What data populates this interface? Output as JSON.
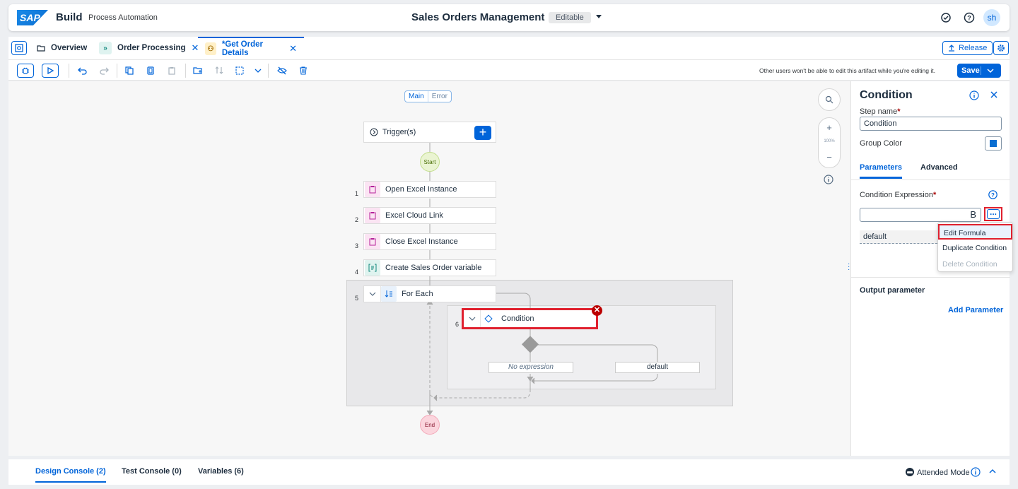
{
  "shell": {
    "logo": "SAP",
    "brand": "Build",
    "product": "Process Automation",
    "project_title": "Sales Orders Management",
    "editable_badge": "Editable",
    "avatar_initials": "sh"
  },
  "tabs": [
    {
      "label": "Overview",
      "icon": "folder-icon"
    },
    {
      "label": "Order Processing",
      "icon": "process-icon"
    },
    {
      "label": "*Get Order Details",
      "icon": "automation-icon"
    }
  ],
  "tabbar": {
    "release_label": "Release"
  },
  "toolbar": {
    "edit_note": "Other users won't be able to edit this artifact while you're editing it.",
    "save_label": "Save"
  },
  "canvas": {
    "main_label": "Main",
    "error_label": "Error",
    "trigger_label": "Trigger(s)",
    "start_label": "Start",
    "end_label": "End",
    "zoom_level": "100%",
    "steps": [
      {
        "num": "1",
        "label": "Open Excel Instance"
      },
      {
        "num": "2",
        "label": "Excel Cloud Link"
      },
      {
        "num": "3",
        "label": "Close Excel Instance"
      },
      {
        "num": "4",
        "label": "Create Sales Order variable"
      },
      {
        "num": "5",
        "label": "For Each"
      },
      {
        "num": "6",
        "label": "Condition"
      }
    ],
    "branch_no_expression": "No expression",
    "branch_default": "default"
  },
  "panel": {
    "title": "Condition",
    "step_name_label": "Step name",
    "step_name_value": "Condition",
    "group_color_label": "Group Color",
    "group_color": "#0a6ed1",
    "tab_parameters": "Parameters",
    "tab_advanced": "Advanced",
    "condition_expression_label": "Condition Expression",
    "default_row": "default",
    "output_parameter_label": "Output parameter",
    "add_parameter_label": "Add Parameter"
  },
  "menu": {
    "edit_formula": "Edit Formula",
    "duplicate_condition": "Duplicate Condition",
    "delete_condition": "Delete Condition"
  },
  "bottom": {
    "design_console": "Design Console (2)",
    "test_console": "Test Console (0)",
    "variables": "Variables (6)",
    "attended_mode": "Attended Mode"
  },
  "colors": {
    "accent": "#0064d9",
    "highlight": "#e0202e"
  }
}
